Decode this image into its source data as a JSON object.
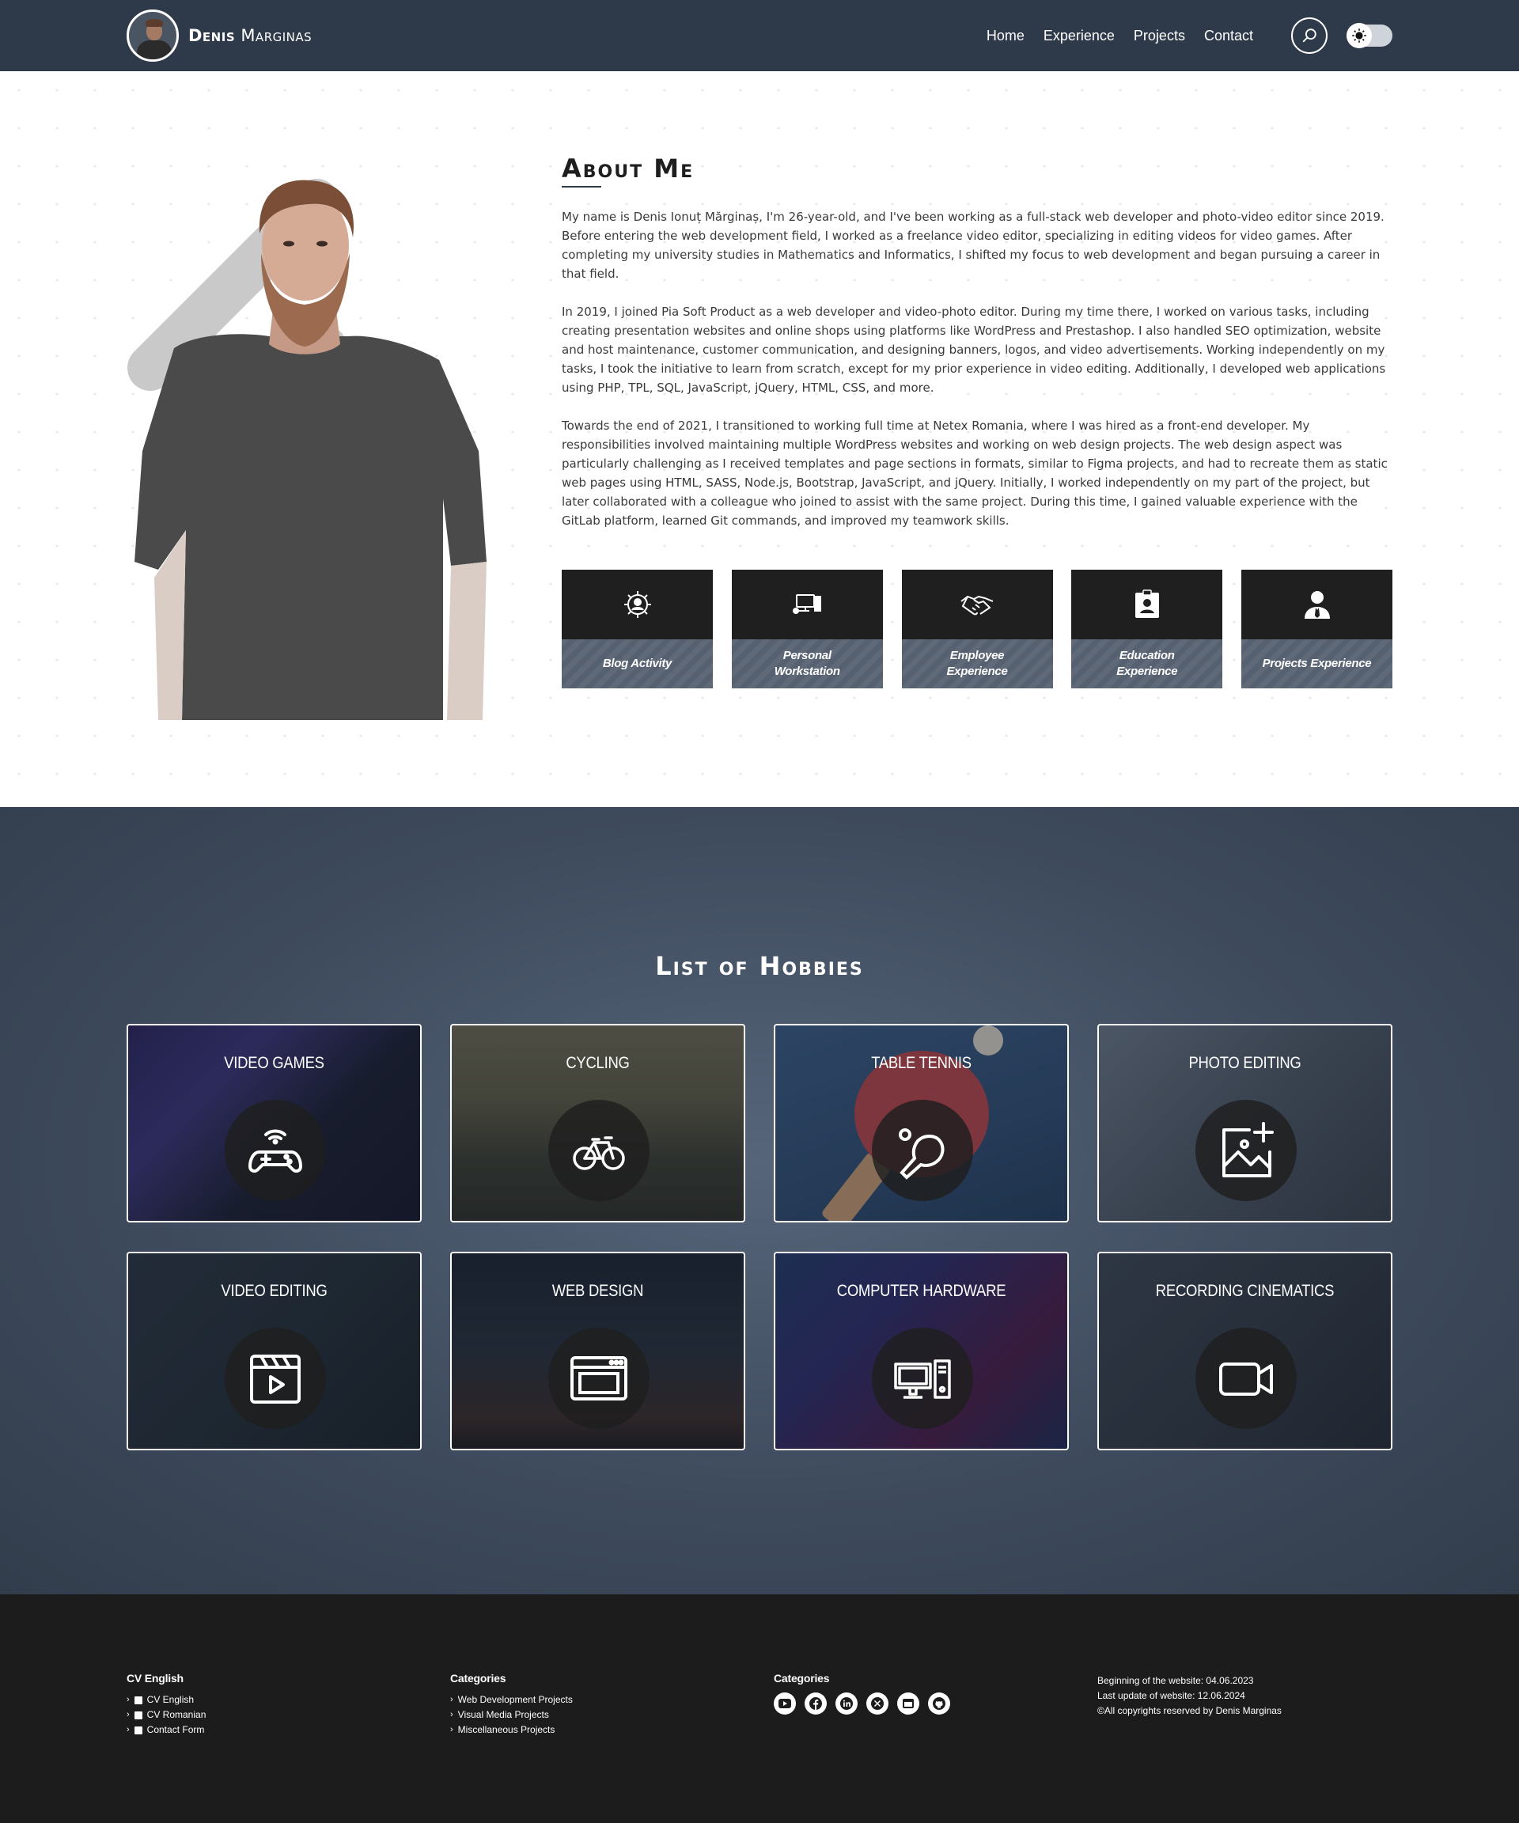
{
  "header": {
    "brand_first": "Denis",
    "brand_last": "Marginas",
    "nav": [
      "Home",
      "Experience",
      "Projects",
      "Contact"
    ],
    "colors": {
      "bar": "#2e3a49"
    }
  },
  "about": {
    "title": "About Me",
    "paragraphs": [
      "My name is Denis Ionuț Mărginaș, I'm 26-year-old, and I've been working as a full-stack web developer and photo-video editor since 2019. Before entering the web development field, I worked as a freelance video editor, specializing in editing videos for video games. After completing my university studies in Mathematics and Informatics, I shifted my focus to web development and began pursuing a career in that field.",
      "In 2019, I joined Pia Soft Product as a web developer and video-photo editor. During my time there, I worked on various tasks, including creating presentation websites and online shops using platforms like WordPress and Prestashop. I also handled SEO optimization, website and host maintenance, customer communication, and designing banners, logos, and video advertisements. Working independently on my tasks, I took the initiative to learn from scratch, except for my prior experience in video editing. Additionally, I developed web applications using PHP, TPL, SQL, JavaScript, jQuery, HTML, CSS, and more.",
      "Towards the end of 2021, I transitioned to working full time at Netex Romania, where I was hired as a front-end developer. My responsibilities involved maintaining multiple WordPress websites and working on web design projects. The web design aspect was particularly challenging as I received templates and page sections in formats, similar to Figma projects, and had to recreate them as static web pages using HTML, SASS, Node.js, Bootstrap, JavaScript, and jQuery. Initially, I worked independently on my part of the project, but later collaborated with a colleague who joined to assist with the same project. During this time, I gained valuable experience with the GitLab platform, learned Git commands, and improved my teamwork skills."
    ],
    "cards": [
      {
        "label_1": "Blog Activity",
        "label_2": "",
        "icon": "gear-user-icon"
      },
      {
        "label_1": "Personal",
        "label_2": "Workstation",
        "icon": "workstation-icon"
      },
      {
        "label_1": "Employee",
        "label_2": "Experience",
        "icon": "handshake-icon"
      },
      {
        "label_1": "Education",
        "label_2": "Experience",
        "icon": "id-badge-icon"
      },
      {
        "label_1": "Projects Experience",
        "label_2": "",
        "icon": "user-tie-icon"
      }
    ]
  },
  "hobbies": {
    "title": "List of Hobbies",
    "items": [
      {
        "label": "Video Games",
        "icon": "gamepad-icon"
      },
      {
        "label": "Cycling",
        "icon": "bicycle-icon"
      },
      {
        "label": "Table Tennis",
        "icon": "ping-pong-icon"
      },
      {
        "label": "Photo Editing",
        "icon": "image-plus-icon"
      },
      {
        "label": "Video Editing",
        "icon": "clapperboard-icon"
      },
      {
        "label": "Web Design",
        "icon": "browser-window-icon"
      },
      {
        "label": "Computer Hardware",
        "icon": "desktop-computer-icon"
      },
      {
        "label": "Recording Cinematics",
        "icon": "video-camera-icon"
      }
    ]
  },
  "footer": {
    "col1": {
      "title": "CV English",
      "links": [
        "CV English",
        "CV Romanian",
        "Contact Form"
      ]
    },
    "col2": {
      "title": "Categories",
      "links": [
        "Web Development Projects",
        "Visual Media Projects",
        "Miscellaneous Projects"
      ]
    },
    "col3": {
      "title": "Categories",
      "socials": [
        "youtube-icon",
        "facebook-icon",
        "linkedin-icon",
        "x-icon",
        "website-icon",
        "github-icon"
      ]
    },
    "info": [
      "Beginning of the website: 04.06.2023",
      "Last update of website: 12.06.2024",
      "©All copyrights reserved by Denis Marginas"
    ]
  }
}
